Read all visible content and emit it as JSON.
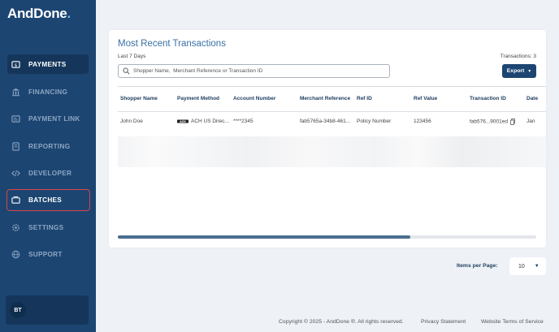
{
  "brand": {
    "name": "AndDone",
    "dot": "."
  },
  "sidebar": {
    "items": [
      {
        "label": "PAYMENTS",
        "icon": "payments-icon"
      },
      {
        "label": "FINANCING",
        "icon": "bank-icon"
      },
      {
        "label": "PAYMENT LINK",
        "icon": "link-card-icon"
      },
      {
        "label": "REPORTING",
        "icon": "report-icon"
      },
      {
        "label": "DEVELOPER",
        "icon": "code-icon"
      },
      {
        "label": "BATCHES",
        "icon": "batch-icon"
      },
      {
        "label": "SETTINGS",
        "icon": "gear-icon"
      },
      {
        "label": "SUPPORT",
        "icon": "globe-icon"
      }
    ],
    "active": "PAYMENTS",
    "highlighted": "BATCHES",
    "user_initials": "BT"
  },
  "card": {
    "title": "Most Recent Transactions",
    "subtitle": "Last 7 Days",
    "transactions_count": "Transactions: 3",
    "search_placeholder": "Shopper Name,  Merchant Reference or Transaction ID",
    "export_label": "Export"
  },
  "table": {
    "columns": [
      "Shopper Name",
      "Payment Method",
      "Account Number",
      "Merchant Reference",
      "Ref ID",
      "Ref Value",
      "Transaction ID",
      "Date"
    ],
    "rows": [
      {
        "shopper_name": "John Doe",
        "payment_method": "ACH US Direc...",
        "account_number": "****2345",
        "merchant_reference": "fab5765a-34b8-461...",
        "ref_id": "Policy Number",
        "ref_value": "123456",
        "transaction_id": "fab576...9001ed",
        "date": "Jan"
      }
    ]
  },
  "pagination": {
    "label": "Items per Page:",
    "value": "10"
  },
  "footer": {
    "copyright": "Copyright © 2025 - AndDone ®. All rights reserved.",
    "privacy": "Privacy Statement",
    "terms": "Website Terms of Service"
  },
  "colors": {
    "sidebar": "#1c4572",
    "accent": "#3a6fa6",
    "highlight": "#d84747",
    "background": "#eef1f6"
  }
}
